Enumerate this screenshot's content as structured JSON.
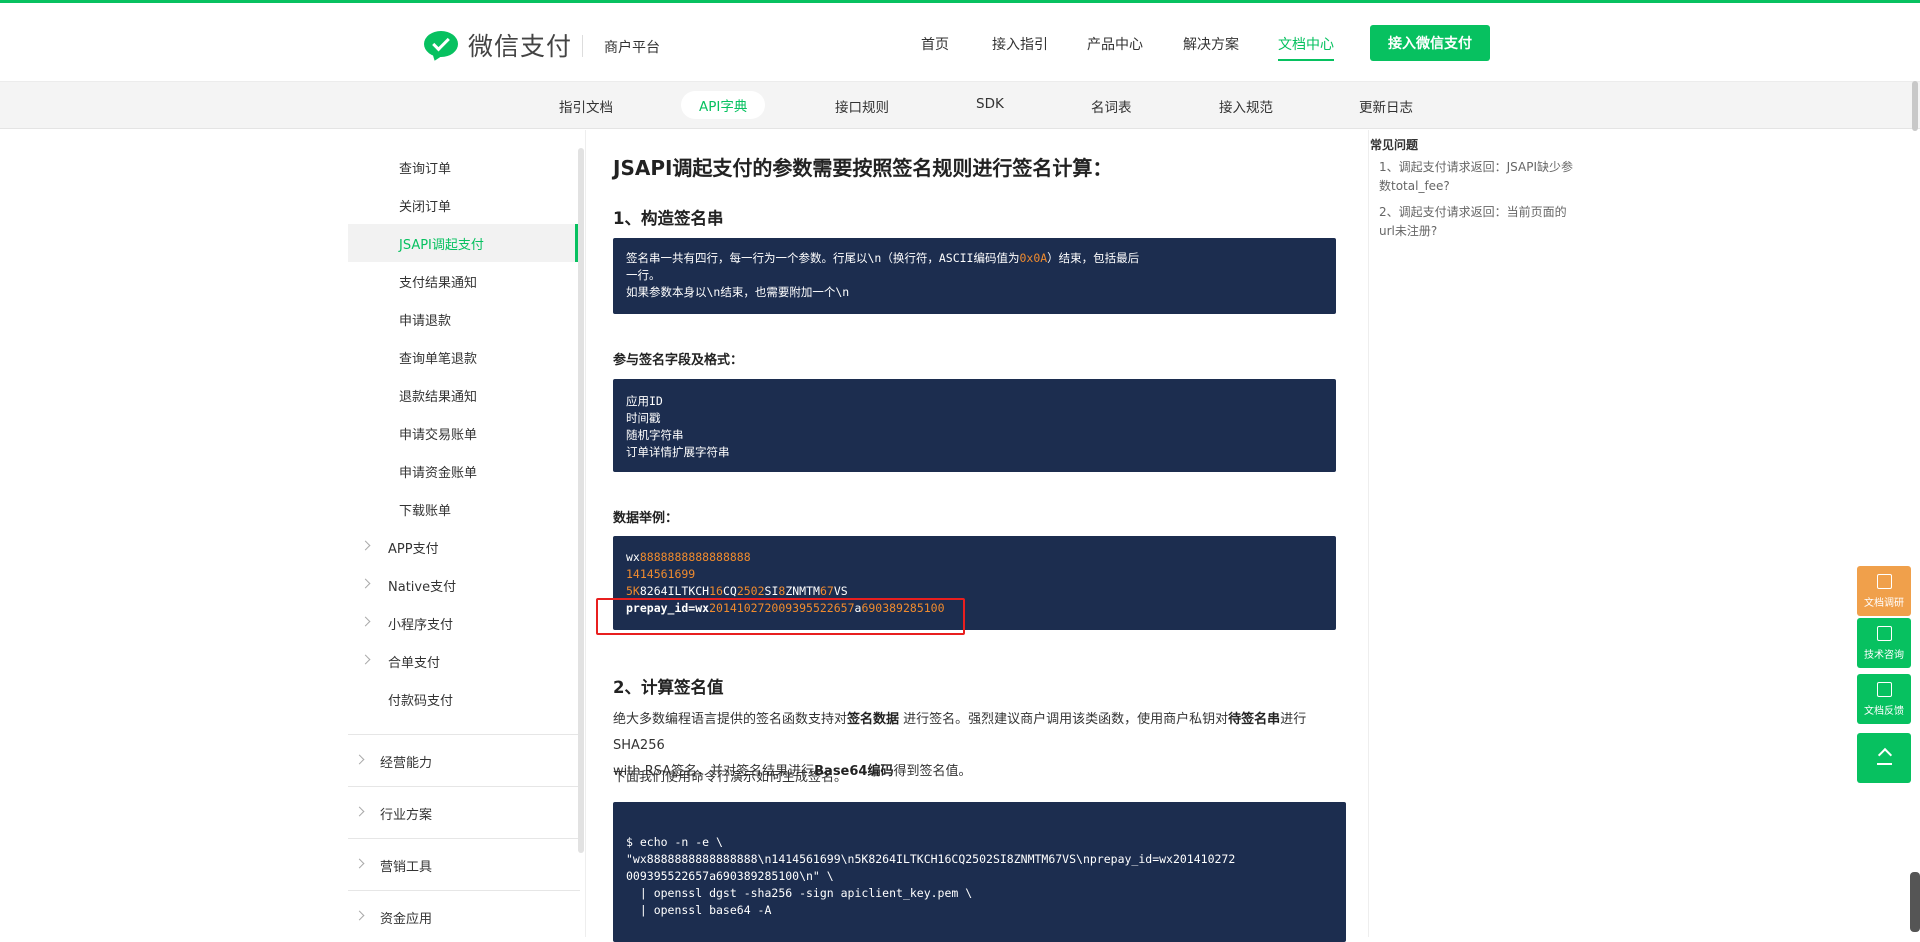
{
  "header": {
    "logo_text": "微信支付",
    "logo_sub": "商户平台",
    "nav": [
      {
        "label": "首页"
      },
      {
        "label": "接入指引"
      },
      {
        "label": "产品中心"
      },
      {
        "label": "解决方案"
      },
      {
        "label": "文档中心",
        "active": true
      }
    ],
    "cta_label": "接入微信支付",
    "accent_color": "#07c160"
  },
  "subnav": {
    "items": [
      {
        "label": "指引文档"
      },
      {
        "label": "API字典",
        "active": true
      },
      {
        "label": "接口规则"
      },
      {
        "label": "SDK"
      },
      {
        "label": "名词表"
      },
      {
        "label": "接入规范"
      },
      {
        "label": "更新日志"
      }
    ]
  },
  "sidebar": {
    "items": [
      {
        "label": "查询订单"
      },
      {
        "label": "关闭订单"
      },
      {
        "label": "JSAPI调起支付",
        "active": true
      },
      {
        "label": "支付结果通知"
      },
      {
        "label": "申请退款"
      },
      {
        "label": "查询单笔退款"
      },
      {
        "label": "退款结果通知"
      },
      {
        "label": "申请交易账单"
      },
      {
        "label": "申请资金账单"
      },
      {
        "label": "下载账单"
      }
    ],
    "groups": [
      {
        "label": "APP支付"
      },
      {
        "label": "Native支付"
      },
      {
        "label": "小程序支付"
      },
      {
        "label": "合单支付"
      },
      {
        "label": "付款码支付"
      }
    ],
    "sections": [
      {
        "label": "经营能力"
      },
      {
        "label": "行业方案"
      },
      {
        "label": "营销工具"
      },
      {
        "label": "资金应用"
      }
    ]
  },
  "content": {
    "title": "JSAPI调起支付的参数需要按照签名规则进行签名计算：",
    "step1_title": "1、构造签名串",
    "code1": {
      "l1a": "签名串一共有四行，每一行为一个参数。行尾以\\n（换行符，ASCII编码值为",
      "l1b": "0x0A",
      "l1c": "）结束，包括最后",
      "l2": "一行。",
      "l3": "如果参数本身以\\n结束，也需要附加一个\\n"
    },
    "fields_label": "参与签名字段及格式：",
    "fields": [
      "应用ID",
      "时间戳",
      "随机字符串",
      "订单详情扩展字符串"
    ],
    "example_label": "数据举例：",
    "example": {
      "l1a": "wx",
      "l1b": "8888888888888888",
      "l2": "1414561699",
      "l3": [
        {
          "t": "5K",
          "c": "o"
        },
        {
          "t": "8264",
          "c": "w"
        },
        {
          "t": "ILTKCH",
          "c": "w"
        },
        {
          "t": "16",
          "c": "o"
        },
        {
          "t": "CQ",
          "c": "w"
        },
        {
          "t": "2502",
          "c": "o"
        },
        {
          "t": "SI",
          "c": "w"
        },
        {
          "t": "8",
          "c": "o"
        },
        {
          "t": "ZNMTM",
          "c": "w"
        },
        {
          "t": "67",
          "c": "o"
        },
        {
          "t": "VS",
          "c": "w"
        }
      ],
      "l4a": "prepay_id=wx",
      "l4b": "201410272009395522657",
      "l4c": "a",
      "l4d": "690389285100"
    },
    "step2_title": "2、计算签名值",
    "para1": {
      "a": "绝大多数编程语言提供的签名函数支持对",
      "b": "签名数据",
      "c": " 进行签名。强烈建议商户调用该类函数，使用商户私钥对",
      "d": "待签名串",
      "e": "进行SHA256",
      "f": "with RSA签名，并对签名结果进行",
      "g": "Base64编码",
      "h": "得到签名值。"
    },
    "para2": "下面我们使用命令行演示如何生成签名。",
    "cmd": [
      "$ echo -n -e \\",
      "\"wx8888888888888888\\n1414561699\\n5K8264ILTKCH16CQ2502SI8ZNMTM67VS\\nprepay_id=wx201410272",
      "009395522657a690389285100\\n\" \\",
      "  | openssl dgst -sha256 -sign apiclient_key.pem \\",
      "  | openssl base64 -A"
    ]
  },
  "faq": {
    "title": "常见问题",
    "items": [
      "1、调起支付请求返回：JSAPI缺少参数total_fee?",
      "2、调起支付请求返回：当前页面的url未注册?"
    ]
  },
  "tools": [
    {
      "label": "文档调研",
      "icon": "edit-icon",
      "color": "#f0a04b"
    },
    {
      "label": "技术咨询",
      "icon": "chat-icon",
      "color": "#07c160"
    },
    {
      "label": "文档反馈",
      "icon": "feedback-icon",
      "color": "#07c160"
    },
    {
      "label": "",
      "icon": "back-to-top-icon",
      "color": "#07c160"
    }
  ]
}
